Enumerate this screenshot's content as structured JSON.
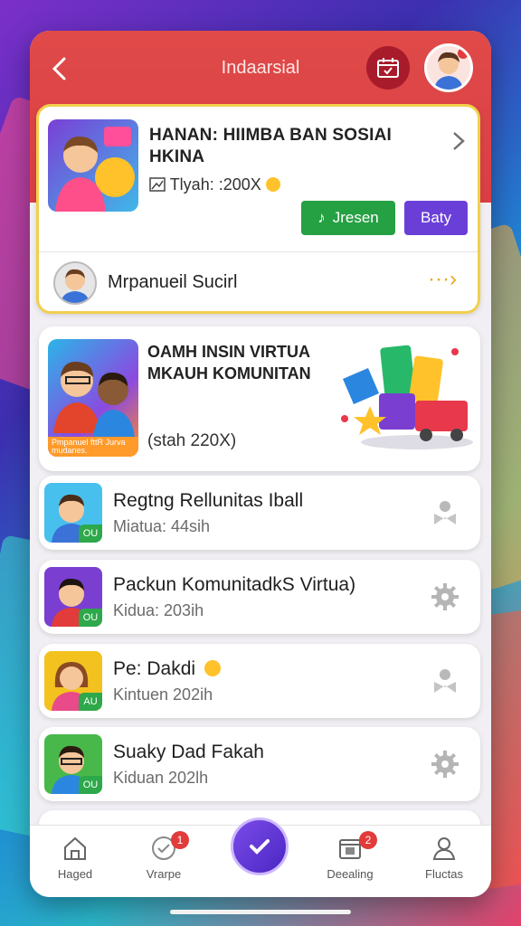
{
  "header": {
    "title": "Indaarsial",
    "back_icon": "chevron-left-icon",
    "calendar_icon": "calendar-icon"
  },
  "featured": {
    "title": "HANAN: HIIMBA BAN SOSIAI HKINA",
    "subtitle": "Tlyah: :200X",
    "primary_button": "Jresen",
    "secondary_button": "Baty",
    "row_label": "Mrpanueil Sucirl",
    "row_more": "···›"
  },
  "promo": {
    "title": "OAMH INSIN VIRTUA MKAUH KOMUNITAN",
    "thumb_caption": "Pmpanuel fttR Jurva mudanes.",
    "subtitle": "(stah 220X)"
  },
  "list": [
    {
      "title": "Regtng Rellunitas Iball",
      "subtitle": "Miatua: 44sih",
      "badge": "OU",
      "icon": "user-badge-icon",
      "color": "#48c0ee"
    },
    {
      "title": "Packun KomunitadkS Virtua)",
      "subtitle": "Kidua: 203ih",
      "badge": "OU",
      "icon": "gear-icon",
      "color": "#7a3fd0"
    },
    {
      "title": "Pe: Dakdi",
      "subtitle": "Kintuen 202ih",
      "badge": "AU",
      "icon": "user-badge-icon",
      "color": "#f3c21f"
    },
    {
      "title": "Suaky Dad Fakah",
      "subtitle": "Kiduan 202lh",
      "badge": "OU",
      "icon": "gear-icon",
      "color": "#48b84a"
    }
  ],
  "tabs": [
    {
      "label": "Haged",
      "icon": "home-icon"
    },
    {
      "label": "Vrarpe",
      "icon": "heart-check-icon",
      "badge": "1"
    },
    {
      "label": "",
      "icon": "checkmark-icon"
    },
    {
      "label": "Deealing",
      "icon": "calendar-icon",
      "badge": "2"
    },
    {
      "label": "Fluctas",
      "icon": "profile-icon"
    }
  ]
}
